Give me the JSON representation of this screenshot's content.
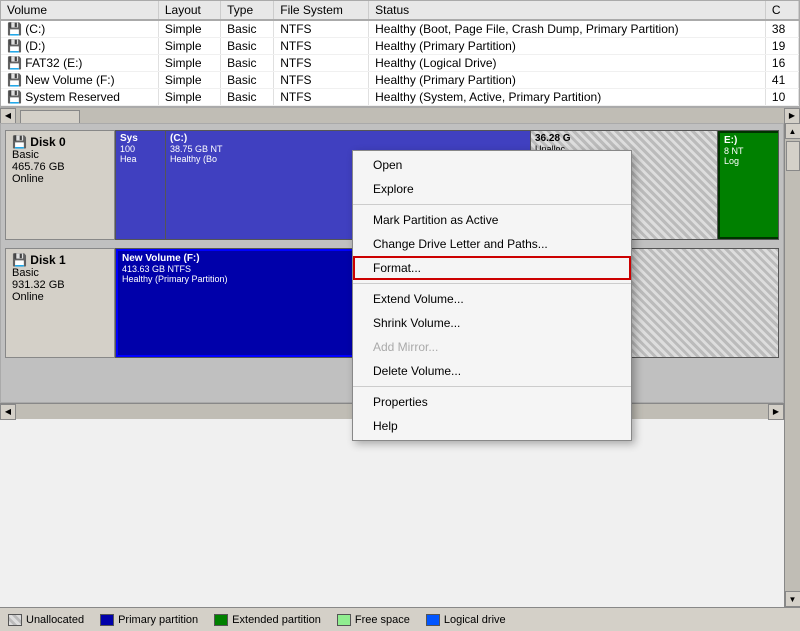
{
  "table": {
    "columns": [
      "Volume",
      "Layout",
      "Type",
      "File System",
      "Status",
      "C"
    ],
    "rows": [
      {
        "volume": "(C:)",
        "layout": "Simple",
        "type": "Basic",
        "fs": "NTFS",
        "status": "Healthy (Boot, Page File, Crash Dump, Primary Partition)",
        "cap": "38"
      },
      {
        "volume": "(D:)",
        "layout": "Simple",
        "type": "Basic",
        "fs": "NTFS",
        "status": "Healthy (Primary Partition)",
        "cap": "19"
      },
      {
        "volume": "FAT32 (E:)",
        "layout": "Simple",
        "type": "Basic",
        "fs": "NTFS",
        "status": "Healthy (Logical Drive)",
        "cap": "16"
      },
      {
        "volume": "New Volume (F:)",
        "layout": "Simple",
        "type": "Basic",
        "fs": "NTFS",
        "status": "Healthy (Primary Partition)",
        "cap": "41"
      },
      {
        "volume": "System Reserved",
        "layout": "Simple",
        "type": "Basic",
        "fs": "NTFS",
        "status": "Healthy (System, Active, Primary Partition)",
        "cap": "10"
      }
    ]
  },
  "context_menu": {
    "items": [
      {
        "label": "Open",
        "id": "open",
        "disabled": false,
        "separator_after": false
      },
      {
        "label": "Explore",
        "id": "explore",
        "disabled": false,
        "separator_after": true
      },
      {
        "label": "Mark Partition as Active",
        "id": "mark-active",
        "disabled": false,
        "separator_after": false
      },
      {
        "label": "Change Drive Letter and Paths...",
        "id": "change-letter",
        "disabled": false,
        "separator_after": false
      },
      {
        "label": "Format...",
        "id": "format",
        "disabled": false,
        "highlighted": true,
        "separator_after": true
      },
      {
        "label": "Extend Volume...",
        "id": "extend",
        "disabled": false,
        "separator_after": false
      },
      {
        "label": "Shrink Volume...",
        "id": "shrink",
        "disabled": false,
        "separator_after": false
      },
      {
        "label": "Add Mirror...",
        "id": "add-mirror",
        "disabled": true,
        "separator_after": false
      },
      {
        "label": "Delete Volume...",
        "id": "delete",
        "disabled": false,
        "separator_after": true
      },
      {
        "label": "Properties",
        "id": "properties",
        "disabled": false,
        "separator_after": false
      },
      {
        "label": "Help",
        "id": "help",
        "disabled": false,
        "separator_after": false
      }
    ]
  },
  "disks": [
    {
      "name": "Disk 0",
      "type": "Basic",
      "size": "465.76 GB",
      "status": "Online",
      "partitions": [
        {
          "label": "Sys",
          "sublabel": "100",
          "detail": "Hea",
          "color": "sys"
        },
        {
          "label": "(C:)",
          "sublabel": "38.75 GB NT",
          "detail": "Healthy (Bo",
          "color": "primary"
        },
        {
          "label": "36.28 G",
          "sublabel": "Unalloc",
          "detail": "",
          "color": "unallocated"
        }
      ],
      "right_partition": {
        "label": "E:)",
        "sublabel": "B NT",
        "detail": "Log",
        "color": "extended"
      }
    },
    {
      "name": "Disk 1",
      "type": "Basic",
      "size": "931.32 GB",
      "status": "Online",
      "partitions": [
        {
          "label": "New Volume (F:)",
          "sublabel": "413.63 GB NTFS",
          "detail": "Healthy (Primary Partition)",
          "color": "newvol"
        }
      ],
      "right_partition": {
        "label": "Unallocated",
        "sublabel": "",
        "detail": "",
        "color": "unallocated"
      }
    }
  ],
  "legend": [
    {
      "label": "Unallocated",
      "color": "#ddd",
      "pattern": true
    },
    {
      "label": "Primary partition",
      "color": "#0000aa"
    },
    {
      "label": "Extended partition",
      "color": "#008000"
    },
    {
      "label": "Free space",
      "color": "#00aa00"
    },
    {
      "label": "Logical drive",
      "color": "#0055ff"
    }
  ]
}
